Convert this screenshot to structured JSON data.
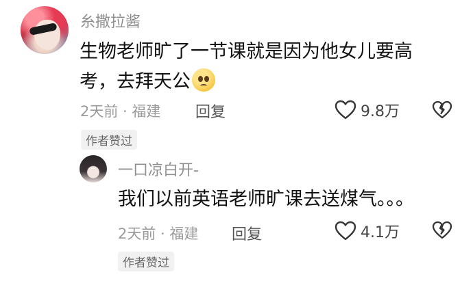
{
  "comment": {
    "username": "糸撒拉酱",
    "text": "生物老师旷了一节课就是因为他女儿要高考，去拜天公",
    "emoji": "pleading-face",
    "time_location": "2天前 · 福建",
    "reply_label": "回复",
    "likes": "9.8万",
    "author_badge": "作者赞过"
  },
  "reply": {
    "username": "一口凉白开-",
    "text": "我们以前英语老师旷课去送煤气。。。",
    "time_location": "2天前 · 福建",
    "reply_label": "回复",
    "likes": "4.1万",
    "author_badge": "作者赞过"
  },
  "colors": {
    "meta_gray": "#9a9a9a",
    "text": "#111111",
    "badge_bg": "#f1f1f1"
  }
}
